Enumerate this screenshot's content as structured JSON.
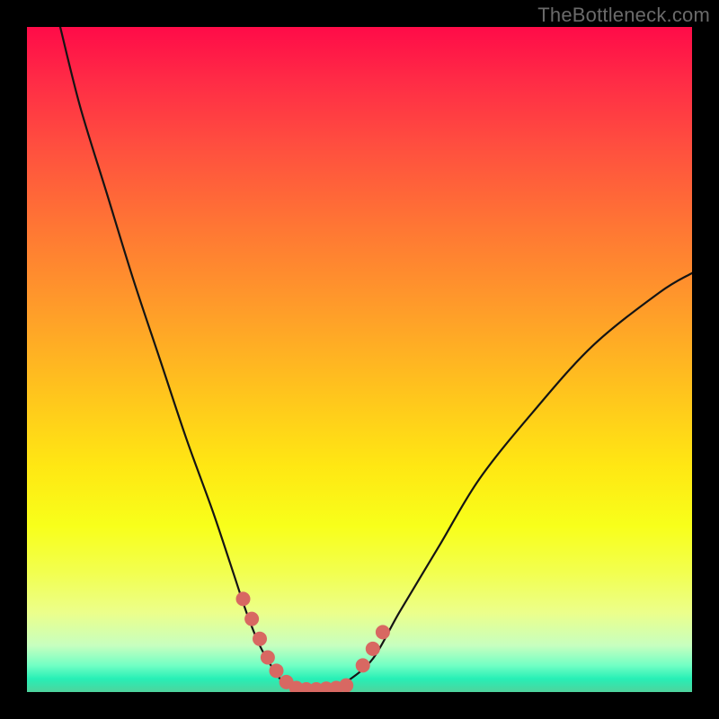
{
  "attribution": "TheBottleneck.com",
  "chart_data": {
    "type": "line",
    "title": "",
    "xlabel": "",
    "ylabel": "",
    "xlim": [
      0,
      100
    ],
    "ylim": [
      0,
      100
    ],
    "series": [
      {
        "name": "bottleneck-curve",
        "x": [
          5,
          8,
          12,
          16,
          20,
          24,
          28,
          31,
          33,
          35,
          37,
          38.5,
          40,
          42,
          44,
          46,
          48,
          52,
          56,
          62,
          68,
          76,
          85,
          95,
          100
        ],
        "y": [
          100,
          88,
          75,
          62,
          50,
          38,
          27,
          18,
          12,
          7,
          3.5,
          1.5,
          0.5,
          0.3,
          0.3,
          0.5,
          1.5,
          5,
          12,
          22,
          32,
          42,
          52,
          60,
          63
        ]
      },
      {
        "name": "optimal-markers-left",
        "x": [
          32.5,
          33.8,
          35.0,
          36.2,
          37.5,
          39.0
        ],
        "y": [
          14.0,
          11.0,
          8.0,
          5.2,
          3.2,
          1.5
        ]
      },
      {
        "name": "optimal-markers-bottom",
        "x": [
          40.5,
          42.0,
          43.5,
          45.0,
          46.5,
          48.0
        ],
        "y": [
          0.6,
          0.4,
          0.4,
          0.5,
          0.6,
          1.0
        ]
      },
      {
        "name": "optimal-markers-right",
        "x": [
          50.5,
          52.0,
          53.5
        ],
        "y": [
          4.0,
          6.5,
          9.0
        ]
      }
    ],
    "annotations": [],
    "legend": null,
    "grid": false
  },
  "colors": {
    "curve": "#141414",
    "marker": "#d86862",
    "attribution": "#6a6a6a",
    "bg_top": "#ff0b48",
    "bg_mid": "#ffe713",
    "bg_bot": "#27efb6"
  }
}
